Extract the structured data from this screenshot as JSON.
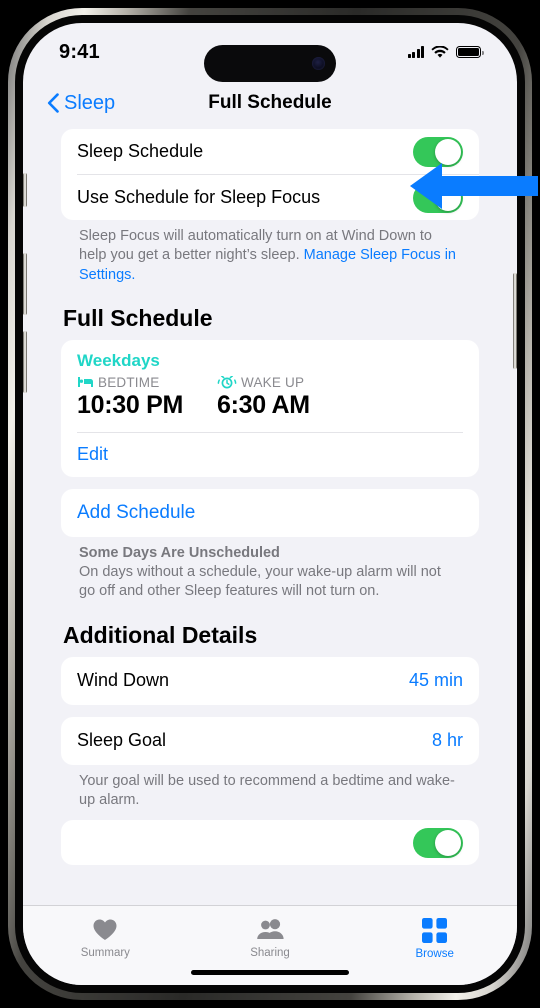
{
  "status_bar": {
    "time": "9:41",
    "signal_icon": "cellular-bars-icon",
    "wifi_icon": "wifi-icon",
    "battery_icon": "battery-full-icon"
  },
  "nav": {
    "back_label": "Sleep",
    "back_icon": "chevron-left-icon",
    "title": "Full Schedule"
  },
  "settings_group": {
    "rows": [
      {
        "label": "Sleep Schedule",
        "toggle": "on"
      },
      {
        "label": "Use Schedule for Sleep Focus",
        "toggle": "on"
      }
    ],
    "footnote_prefix": "Sleep Focus will automatically turn on at Wind Down to help you get a better night’s sleep. ",
    "footnote_link": "Manage Sleep Focus in Settings."
  },
  "full_schedule": {
    "heading": "Full Schedule",
    "days_label": "Weekdays",
    "bedtime": {
      "icon": "bed-icon",
      "caption": "BEDTIME",
      "time": "10:30 PM"
    },
    "wake_up": {
      "icon": "alarm-clock-icon",
      "caption": "WAKE UP",
      "time": "6:30 AM"
    },
    "edit_label": "Edit",
    "add_schedule_label": "Add Schedule",
    "note_title": "Some Days Are Unscheduled",
    "note_body": "On days without a schedule, your wake-up alarm will not go off and other Sleep features will not turn on."
  },
  "additional_details": {
    "heading": "Additional Details",
    "wind_down": {
      "label": "Wind Down",
      "value": "45 min"
    },
    "sleep_goal": {
      "label": "Sleep Goal",
      "value": "8 hr"
    },
    "sleep_goal_footnote": "Your goal will be used to recommend a bedtime and wake-up alarm."
  },
  "tab_bar": {
    "tabs": [
      {
        "label": "Summary",
        "icon": "heart-icon",
        "active": false
      },
      {
        "label": "Sharing",
        "icon": "people-icon",
        "active": false
      },
      {
        "label": "Browse",
        "icon": "grid-icon",
        "active": true
      }
    ]
  },
  "annotation": {
    "arrow_icon": "left-arrow-annotation",
    "color": "#0a7cff",
    "points_at": "Sleep Schedule"
  },
  "colors": {
    "accent_blue": "#0a7cff",
    "toggle_green": "#34c759",
    "teal": "#20d6c7",
    "background": "#f2f2f7"
  }
}
